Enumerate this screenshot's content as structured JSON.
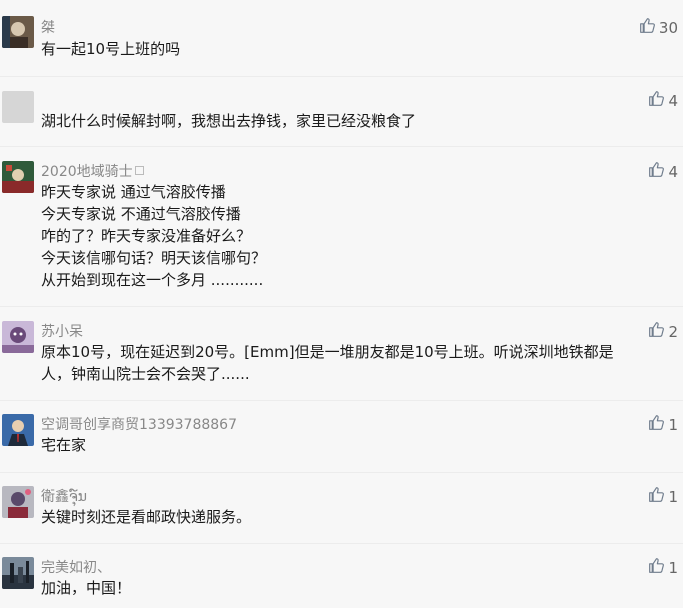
{
  "comments": [
    {
      "name": "桀",
      "text_lines": [
        "有一起10号上班的吗"
      ],
      "likes": "30"
    },
    {
      "name": "",
      "text_lines": [
        "湖北什么时候解封啊，我想出去挣钱，家里已经没粮食了"
      ],
      "likes": "4"
    },
    {
      "name": "2020地域骑士",
      "text_lines": [
        "昨天专家说 通过气溶胶传播",
        "今天专家说 不通过气溶胶传播",
        "咋的了？昨天专家没准备好么？",
        "今天该信哪句话？明天该信哪句？",
        "从开始到现在这一个多月 ..........."
      ],
      "likes": "4"
    },
    {
      "name": "苏小呆",
      "text_lines": [
        "原本10号，现在延迟到20号。[Emm]但是一堆朋友都是10号上班。听说深圳地铁都是",
        "人，钟南山院士会不会哭了......"
      ],
      "likes": "2"
    },
    {
      "name": "空调哥创享商贸13393788867",
      "text_lines": [
        "宅在家"
      ],
      "likes": "1"
    },
    {
      "name": "衛鑫ຈຸ໌ນ",
      "text_lines": [
        "关键时刻还是看邮政快递服务。"
      ],
      "likes": "1"
    },
    {
      "name": "完美如初、",
      "text_lines": [
        "加油，中国！"
      ],
      "likes": "1"
    }
  ],
  "colors": {
    "name": "#888888",
    "text": "#1a1a1a",
    "like": "#666666",
    "background": "#f7f7f7"
  },
  "icons": {
    "like": "thumbs-up-icon"
  }
}
